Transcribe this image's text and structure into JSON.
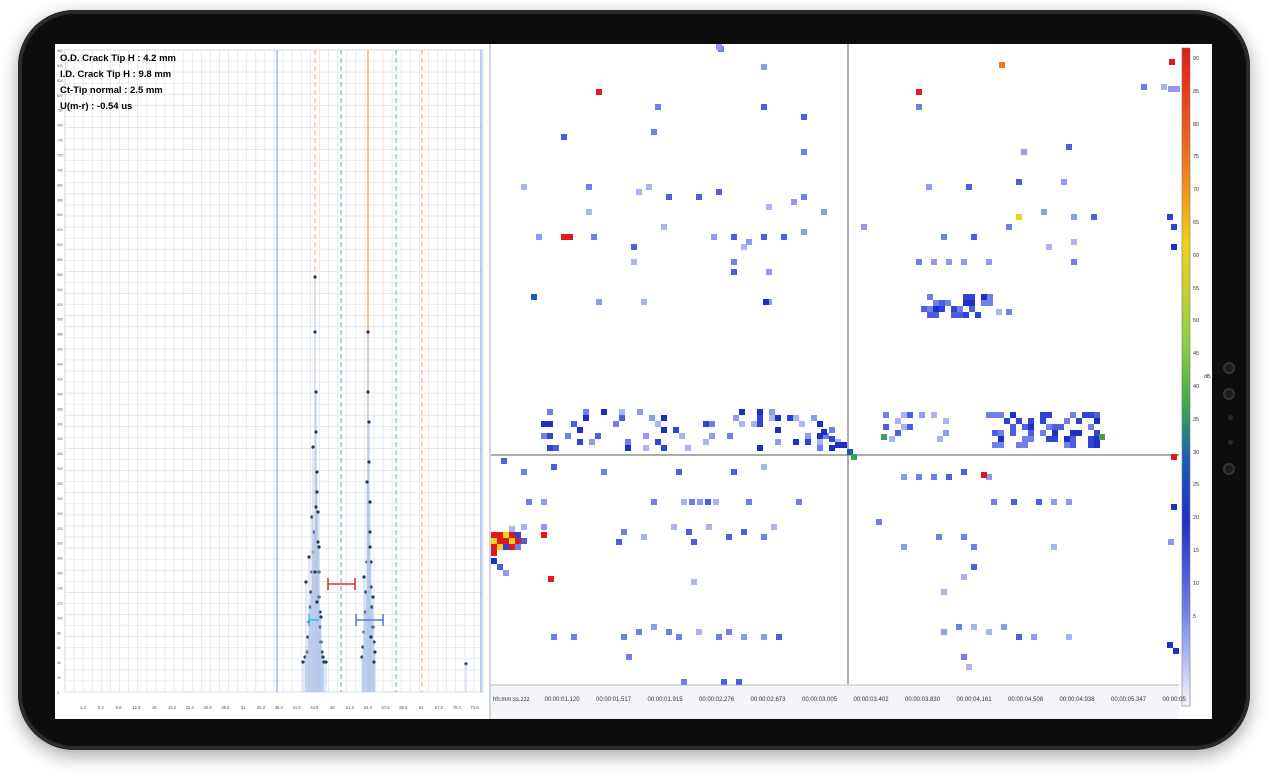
{
  "readouts": [
    "O.D. Crack Tip H : 4.2 mm",
    "I.D. Crack Tip H : 9.8 mm",
    "Ct-Tip normal : 2.5 mm",
    "U(m-r) : -0.54 us"
  ],
  "left_chart": {
    "x_ticks": [
      "3.2",
      "6.4",
      "9.6",
      "12.8",
      "16",
      "19.2",
      "22.4",
      "25.6",
      "28.8",
      "32",
      "35.2",
      "38.4",
      "41.6",
      "44.8",
      "48",
      "51.2",
      "54.4",
      "57.6",
      "60.8",
      "64",
      "67.2",
      "70.4",
      "73.6"
    ],
    "y_range": [
      0,
      860
    ],
    "cursor_colors": {
      "orange": "#f4a460",
      "teal": "#5fb3a8",
      "blue": "#4f7fd6",
      "red": "#e03030",
      "cyan": "#33c6e8"
    }
  },
  "time_axis": {
    "labels": [
      "hh:mm:ss.zzz",
      "00:00:01.120",
      "00:00:01.517",
      "00:00:01.915",
      "00:00:02.276",
      "00:00:02.673",
      "00:00:03.005",
      "00:00:03.402",
      "00:00:03.830",
      "00:00:04.161",
      "00:00:04.508",
      "00:00:04.938",
      "00:00:05.347",
      "00:00:05"
    ]
  },
  "color_scale": {
    "ticks": [
      "90",
      "85",
      "80",
      "75",
      "70",
      "65",
      "60",
      "55",
      "50",
      "45",
      "40",
      "35",
      "30",
      "25",
      "20",
      "15",
      "10",
      "5"
    ],
    "unit": "dB"
  }
}
